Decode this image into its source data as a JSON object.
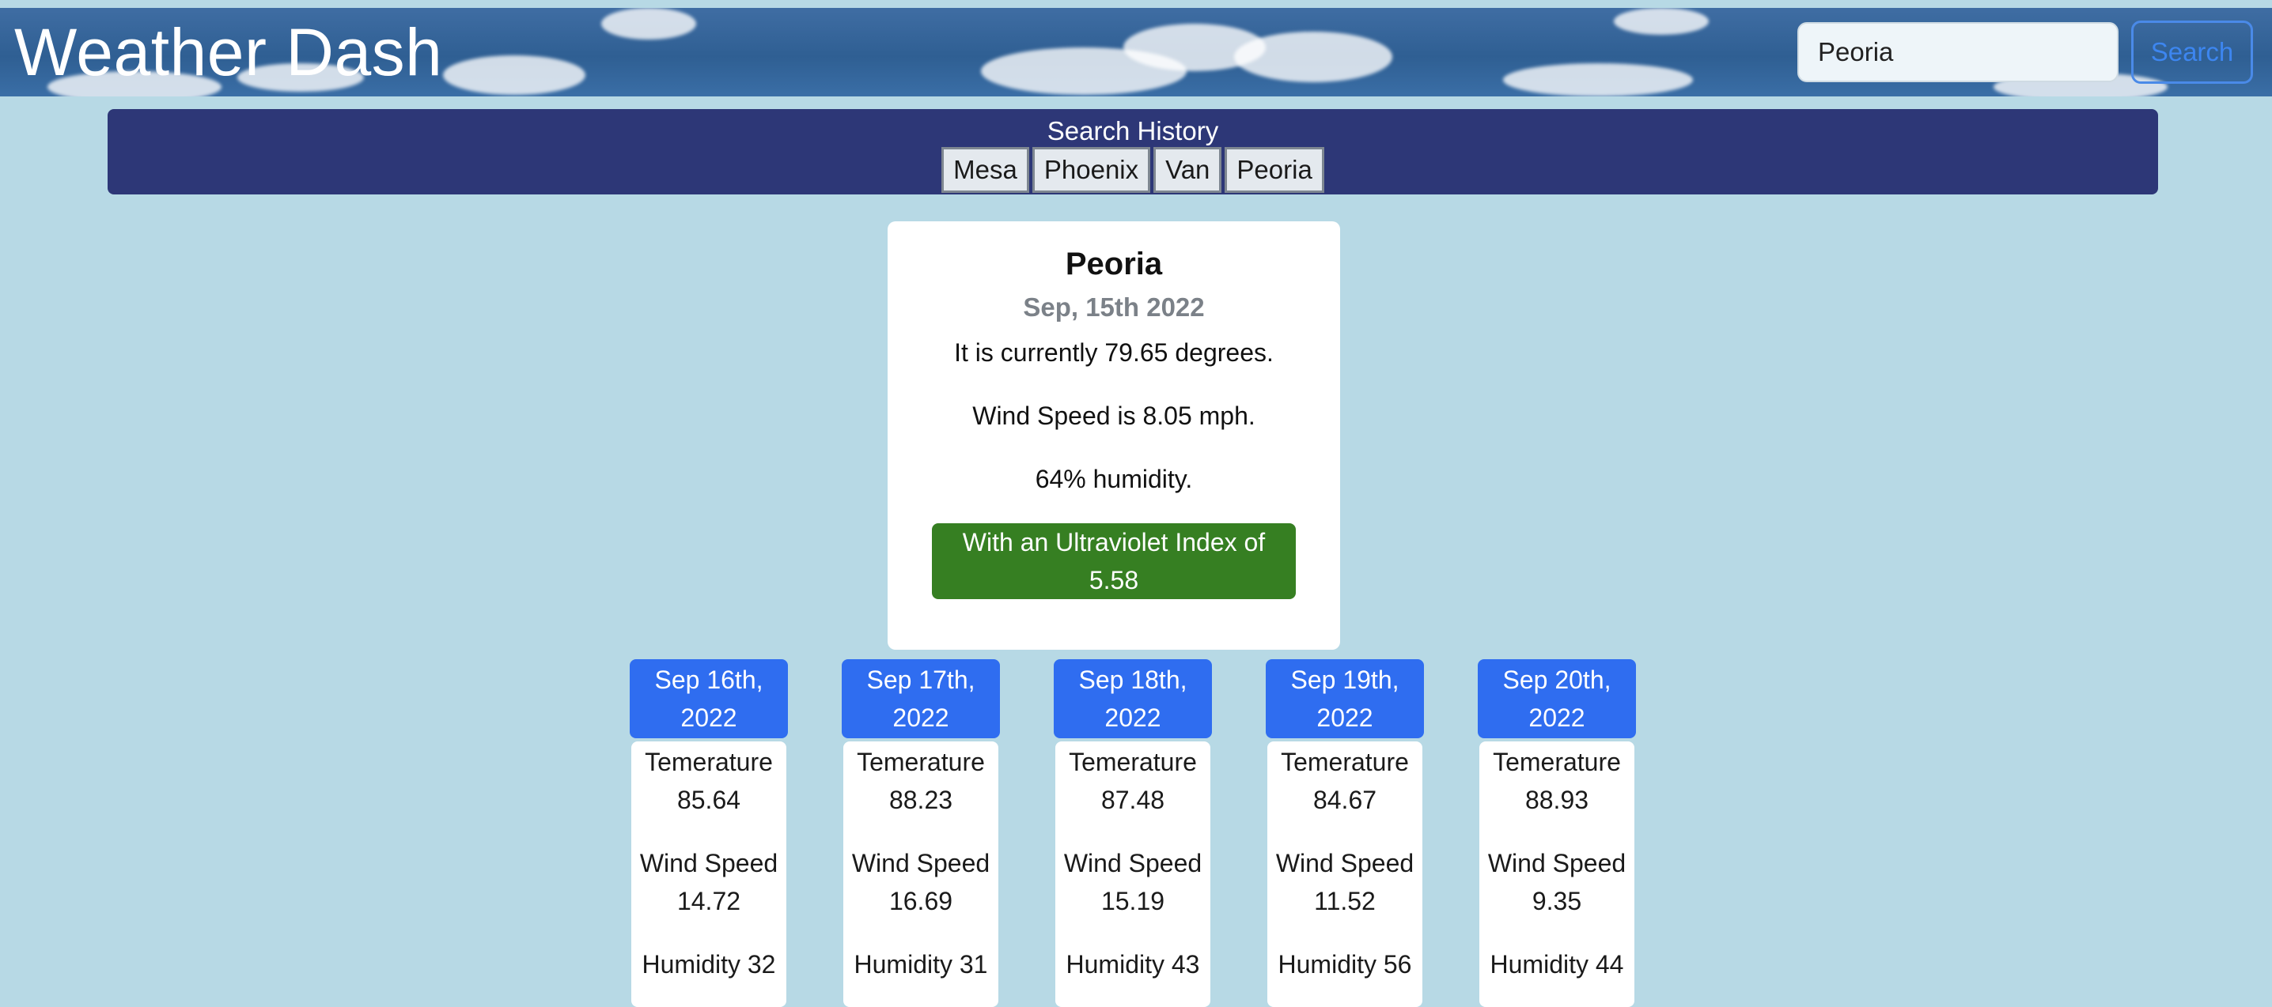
{
  "header": {
    "title": "Weather Dash",
    "search_value": "Peoria",
    "search_button": "Search"
  },
  "history": {
    "title": "Search History",
    "items": [
      "Mesa",
      "Phoenix",
      "Van",
      "Peoria"
    ]
  },
  "current": {
    "city": "Peoria",
    "date": "Sep, 15th 2022",
    "temp_text": "It is currently 79.65 degrees.",
    "wind_text": "Wind Speed is 8.05 mph.",
    "humidity_text": "64% humidity.",
    "uv_line1": "With an Ultraviolet Index of",
    "uv_line2": "5.58",
    "uv_color": "#367f22"
  },
  "forecast": [
    {
      "date_line1": "Sep 16th,",
      "date_line2": "2022",
      "temp_label": "Temerature",
      "temp": "85.64",
      "wind_label": "Wind Speed",
      "wind": "14.72",
      "humidity": "Humidity 32"
    },
    {
      "date_line1": "Sep 17th,",
      "date_line2": "2022",
      "temp_label": "Temerature",
      "temp": "88.23",
      "wind_label": "Wind Speed",
      "wind": "16.69",
      "humidity": "Humidity 31"
    },
    {
      "date_line1": "Sep 18th,",
      "date_line2": "2022",
      "temp_label": "Temerature",
      "temp": "87.48",
      "wind_label": "Wind Speed",
      "wind": "15.19",
      "humidity": "Humidity 43"
    },
    {
      "date_line1": "Sep 19th,",
      "date_line2": "2022",
      "temp_label": "Temerature",
      "temp": "84.67",
      "wind_label": "Wind Speed",
      "wind": "11.52",
      "humidity": "Humidity 56"
    },
    {
      "date_line1": "Sep 20th,",
      "date_line2": "2022",
      "temp_label": "Temerature",
      "temp": "88.93",
      "wind_label": "Wind Speed",
      "wind": "9.35",
      "humidity": "Humidity 44"
    }
  ],
  "colors": {
    "page_bg": "#b7d9e5",
    "history_bg": "#2d3777",
    "forecast_header": "#2f6df0",
    "search_button": "#3d86f0"
  }
}
